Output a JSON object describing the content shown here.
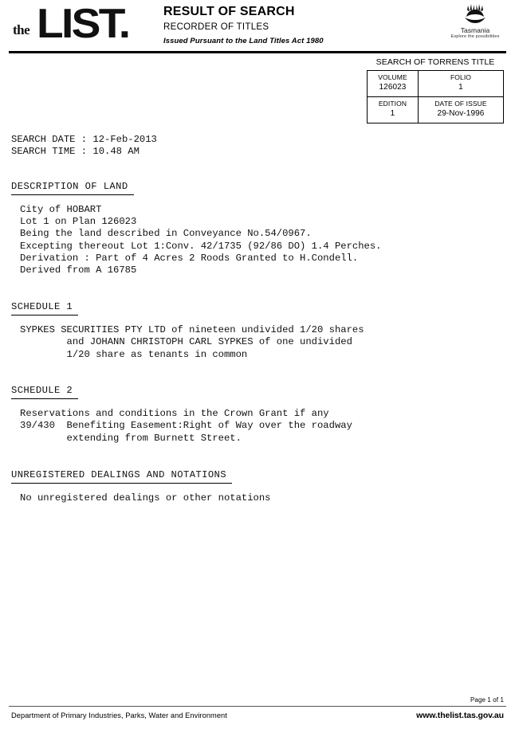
{
  "header": {
    "logo_the": "the",
    "logo_list": "LIST.",
    "title_main": "RESULT OF SEARCH",
    "title_sub": "RECORDER OF TITLES",
    "title_issued": "Issued Pursuant to the Land Titles Act 1980",
    "tasmania_name": "Tasmania",
    "tasmania_tagline": "Explore the possibilities"
  },
  "torrens": {
    "heading": "SEARCH OF TORRENS TITLE",
    "volume_label": "VOLUME",
    "volume_value": "126023",
    "folio_label": "FOLIO",
    "folio_value": "1",
    "edition_label": "EDITION",
    "edition_value": "1",
    "date_of_issue_label": "DATE OF ISSUE",
    "date_of_issue_value": "29-Nov-1996"
  },
  "search": {
    "date_line": "SEARCH DATE : 12-Feb-2013",
    "time_line": "SEARCH TIME : 10.48 AM"
  },
  "description_of_land": {
    "title": "DESCRIPTION OF LAND",
    "body": "City of HOBART\nLot 1 on Plan 126023\nBeing the land described in Conveyance No.54/0967.\nExcepting thereout Lot 1:Conv. 42/1735 (92/86 DO) 1.4 Perches.\nDerivation : Part of 4 Acres 2 Roods Granted to H.Condell.\nDerived from A 16785"
  },
  "schedule_1": {
    "title": "SCHEDULE 1",
    "body": "SYPKES SECURITIES PTY LTD of nineteen undivided 1/20 shares\n        and JOHANN CHRISTOPH CARL SYPKES of one undivided\n        1/20 share as tenants in common"
  },
  "schedule_2": {
    "title": "SCHEDULE 2",
    "body": "Reservations and conditions in the Crown Grant if any\n39/430  Benefiting Easement:Right of Way over the roadway\n        extending from Burnett Street."
  },
  "unregistered": {
    "title": "UNREGISTERED DEALINGS AND NOTATIONS",
    "body": "No unregistered dealings or other notations"
  },
  "footer": {
    "page_number": "Page 1 of  1",
    "department": "Department of Primary Industries, Parks, Water and Environment",
    "website": "www.thelist.tas.gov.au"
  }
}
